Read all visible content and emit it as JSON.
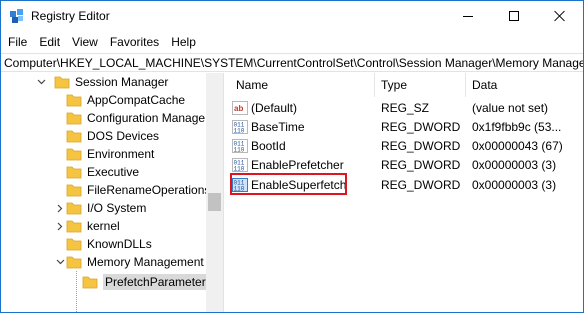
{
  "window": {
    "title": "Registry Editor",
    "accent_color": "#1a73c8"
  },
  "menu": [
    "File",
    "Edit",
    "View",
    "Favorites",
    "Help"
  ],
  "address": "Computer\\HKEY_LOCAL_MACHINE\\SYSTEM\\CurrentControlSet\\Control\\Session Manager\\Memory Manage",
  "tree": [
    {
      "label": "Session Manager",
      "expanded": true,
      "selected": false
    },
    {
      "label": "AppCompatCache",
      "expanded": false,
      "selected": false
    },
    {
      "label": "Configuration Manage",
      "expanded": false,
      "selected": false
    },
    {
      "label": "DOS Devices",
      "expanded": false,
      "selected": false
    },
    {
      "label": "Environment",
      "expanded": false,
      "selected": false
    },
    {
      "label": "Executive",
      "expanded": false,
      "selected": false
    },
    {
      "label": "FileRenameOperations",
      "expanded": false,
      "selected": false
    },
    {
      "label": "I/O System",
      "expanded": false,
      "selected": false
    },
    {
      "label": "kernel",
      "expanded": false,
      "selected": false
    },
    {
      "label": "KnownDLLs",
      "expanded": false,
      "selected": false
    },
    {
      "label": "Memory Management",
      "expanded": true,
      "selected": false
    },
    {
      "label": "PrefetchParameters",
      "expanded": false,
      "selected": true
    }
  ],
  "columns": {
    "name": "Name",
    "type": "Type",
    "data": "Data"
  },
  "values": [
    {
      "icon": "string-value-icon",
      "name": "(Default)",
      "type": "REG_SZ",
      "data": "(value not set)"
    },
    {
      "icon": "binary-value-icon",
      "name": "BaseTime",
      "type": "REG_DWORD",
      "data": "0x1f9fbb9c (53..."
    },
    {
      "icon": "binary-value-icon",
      "name": "BootId",
      "type": "REG_DWORD",
      "data": "0x00000043 (67)"
    },
    {
      "icon": "binary-value-icon",
      "name": "EnablePrefetcher",
      "type": "REG_DWORD",
      "data": "0x00000003 (3)"
    },
    {
      "icon": "binary-value-icon",
      "name": "EnableSuperfetch",
      "type": "REG_DWORD",
      "data": "0x00000003 (3)"
    }
  ],
  "highlight_color": "#e0141e",
  "folder_color": "#f5c542"
}
